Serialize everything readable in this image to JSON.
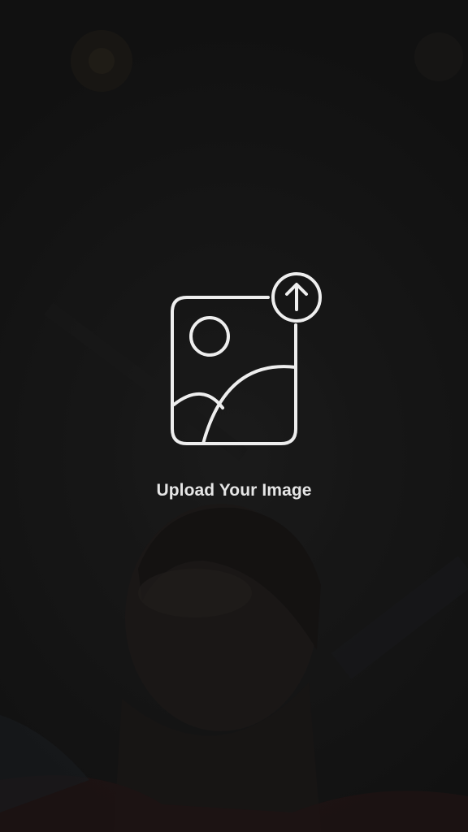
{
  "upload": {
    "label": "Upload Your Image",
    "icon": "image-upload-icon",
    "arrow_icon": "arrow-up-icon"
  },
  "colors": {
    "background": "#141414",
    "icon_stroke": "#eeeeee",
    "label": "#e6e6e6"
  }
}
